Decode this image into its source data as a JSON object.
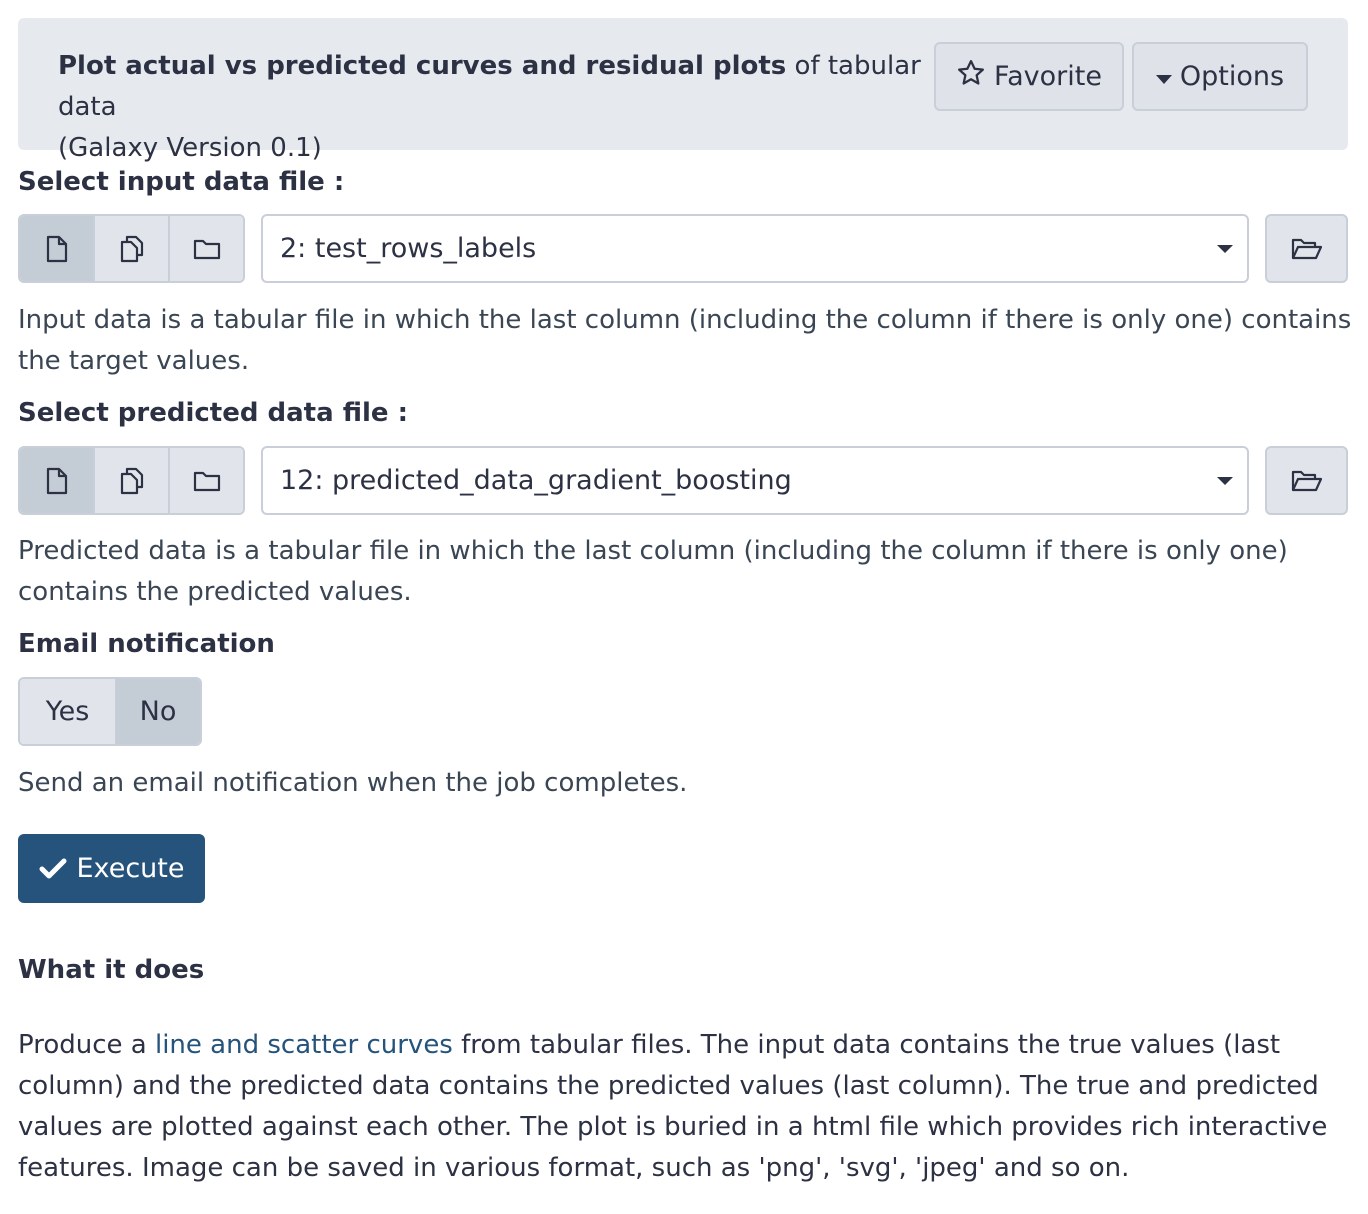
{
  "header": {
    "tool_name": "Plot actual vs predicted curves and residual plots",
    "tool_description": " of tabular data",
    "version": "(Galaxy Version 0.1)",
    "favorite_label": "Favorite",
    "options_label": "Options"
  },
  "input_file": {
    "label": "Select input data file :",
    "selected": "2: test_rows_labels",
    "help": "Input data is a tabular file in which the last column (including the column if there is only one) contains the target values."
  },
  "predicted_file": {
    "label": "Select predicted data file :",
    "selected": "12: predicted_data_gradient_boosting",
    "help": "Predicted data is a tabular file in which the last column (including the column if there is only one) contains the predicted values."
  },
  "email": {
    "label": "Email notification",
    "yes_label": "Yes",
    "no_label": "No",
    "selected": "No",
    "help": "Send an email notification when the job completes."
  },
  "execute_label": "Execute",
  "help_section": {
    "heading": "What it does",
    "text_before_link": "Produce a ",
    "link_text": "line and scatter curves",
    "text_after_link": " from tabular files. The input data contains the true values (last column) and the predicted data contains the predicted values (last column). The true and predicted values are plotted against each other. The plot is buried in a html file which provides rich interactive features. Image can be saved in various format, such as 'png', 'svg', 'jpeg' and so on."
  },
  "colors": {
    "header_bg": "#e6eaef",
    "primary": "#25537b",
    "link": "#25537b",
    "text": "#2c3143"
  },
  "icons": {
    "favorite": "star-outline-icon",
    "options": "caret-down-icon",
    "single_dataset": "file-icon",
    "multiple_datasets": "files-icon",
    "collection": "folder-icon",
    "browse": "folder-open-icon",
    "execute": "check-icon"
  }
}
